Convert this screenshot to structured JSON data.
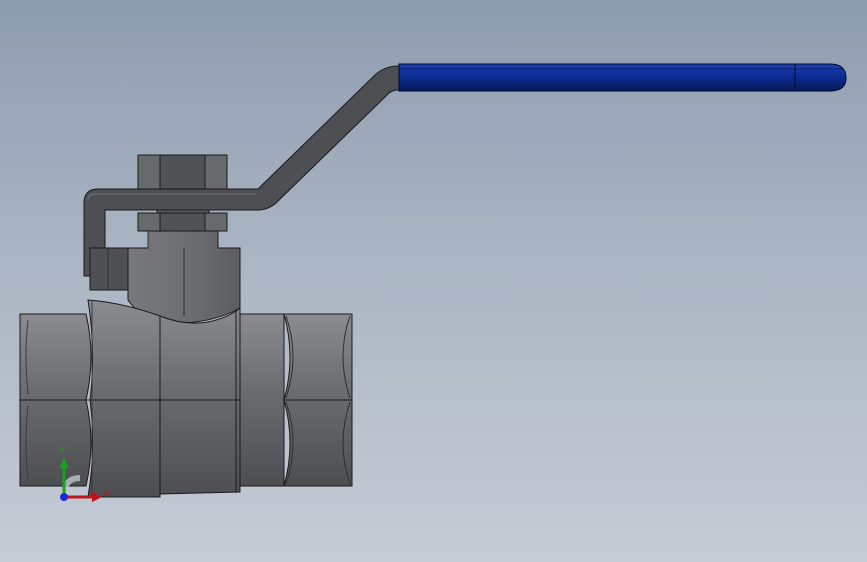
{
  "viewport": {
    "background_top": "#8d9caf",
    "background_bottom": "#c6cbd5"
  },
  "model": {
    "handle_grip_color": "#0b2a8f",
    "lever_color": "#4a4c50",
    "body_color": "#6d6f72",
    "body_dark_color": "#4a4c4f",
    "edge_color": "#1a1a1a"
  },
  "triad": {
    "y_label": "Y",
    "x_label": "X",
    "y_axis_color": "#1aa31a",
    "x_axis_color": "#c0141a",
    "z_axis_color": "#1a2bd6"
  }
}
